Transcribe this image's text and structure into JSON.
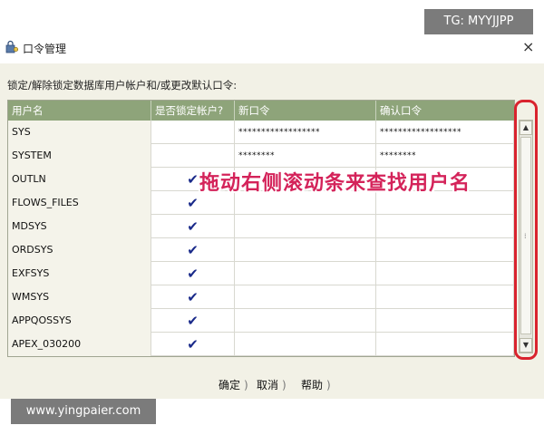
{
  "window": {
    "title": "口令管理",
    "close_glyph": "×",
    "icon": "lock-key-icon"
  },
  "instruction": "锁定/解除锁定数据库用户帐户和/或更改默认口令:",
  "table": {
    "headers": [
      "用户名",
      "是否锁定帐户?",
      "新口令",
      "确认口令"
    ],
    "rows": [
      {
        "username": "SYS",
        "locked": false,
        "new_password": "******************",
        "confirm_password": "******************"
      },
      {
        "username": "SYSTEM",
        "locked": false,
        "new_password": "********",
        "confirm_password": "********"
      },
      {
        "username": "OUTLN",
        "locked": true,
        "new_password": "",
        "confirm_password": ""
      },
      {
        "username": "FLOWS_FILES",
        "locked": true,
        "new_password": "",
        "confirm_password": ""
      },
      {
        "username": "MDSYS",
        "locked": true,
        "new_password": "",
        "confirm_password": ""
      },
      {
        "username": "ORDSYS",
        "locked": true,
        "new_password": "",
        "confirm_password": ""
      },
      {
        "username": "EXFSYS",
        "locked": true,
        "new_password": "",
        "confirm_password": ""
      },
      {
        "username": "WMSYS",
        "locked": true,
        "new_password": "",
        "confirm_password": ""
      },
      {
        "username": "APPQOSSYS",
        "locked": true,
        "new_password": "",
        "confirm_password": ""
      },
      {
        "username": "APEX_030200",
        "locked": true,
        "new_password": "",
        "confirm_password": ""
      }
    ],
    "check_glyph": "✔"
  },
  "scrollbar": {
    "up_glyph": "▲",
    "down_glyph": "▼",
    "grip_glyph": "⁞"
  },
  "annotation": {
    "text": "拖动右侧滚动条来查找用户名",
    "color": "#d4235a",
    "outline_color": "#d9232e"
  },
  "buttons": {
    "ok": "确定",
    "cancel": "取消",
    "help": "帮助"
  },
  "watermarks": {
    "top_right": "TG: MYYJJPP",
    "bottom_left": "www.yingpaier.com"
  },
  "colors": {
    "header_bg": "#8ea47a",
    "panel_bg": "#f2f1e6",
    "check_color": "#1a2a8a"
  }
}
